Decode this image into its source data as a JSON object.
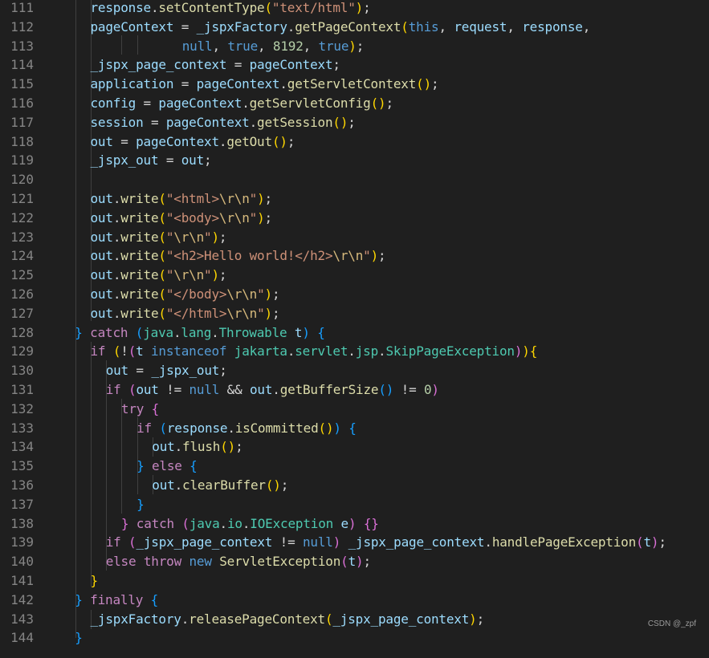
{
  "editor": {
    "lines": [
      {
        "n": "111",
        "t": [
          [
            "response",
            "sv"
          ],
          [
            ".",
            "pu"
          ],
          [
            "setContentType",
            "fn"
          ],
          [
            "(",
            "b1"
          ],
          [
            "\"text/html\"",
            "st"
          ],
          [
            ")",
            "b1"
          ],
          [
            ";",
            "pu"
          ]
        ]
      },
      {
        "n": "112",
        "t": [
          [
            "pageContext",
            "sv"
          ],
          [
            " = ",
            "pu"
          ],
          [
            "_jspxFactory",
            "sv"
          ],
          [
            ".",
            "pu"
          ],
          [
            "getPageContext",
            "fn"
          ],
          [
            "(",
            "b1"
          ],
          [
            "this",
            "kw"
          ],
          [
            ", ",
            "pu"
          ],
          [
            "request",
            "sv"
          ],
          [
            ", ",
            "pu"
          ],
          [
            "response",
            "sv"
          ],
          [
            ",",
            "pu"
          ]
        ]
      },
      {
        "n": "113",
        "t": [
          [
            "      ",
            "pu"
          ],
          [
            "null",
            "kw"
          ],
          [
            ", ",
            "pu"
          ],
          [
            "true",
            "kw"
          ],
          [
            ", ",
            "pu"
          ],
          [
            "8192",
            "nm"
          ],
          [
            ", ",
            "pu"
          ],
          [
            "true",
            "kw"
          ],
          [
            ")",
            "b1"
          ],
          [
            ";",
            "pu"
          ]
        ]
      },
      {
        "n": "114",
        "t": [
          [
            "_jspx_page_context",
            "sv"
          ],
          [
            " = ",
            "pu"
          ],
          [
            "pageContext",
            "sv"
          ],
          [
            ";",
            "pu"
          ]
        ]
      },
      {
        "n": "115",
        "t": [
          [
            "application",
            "sv"
          ],
          [
            " = ",
            "pu"
          ],
          [
            "pageContext",
            "sv"
          ],
          [
            ".",
            "pu"
          ],
          [
            "getServletContext",
            "fn"
          ],
          [
            "(",
            "b1"
          ],
          [
            ")",
            "b1"
          ],
          [
            ";",
            "pu"
          ]
        ]
      },
      {
        "n": "116",
        "t": [
          [
            "config",
            "sv"
          ],
          [
            " = ",
            "pu"
          ],
          [
            "pageContext",
            "sv"
          ],
          [
            ".",
            "pu"
          ],
          [
            "getServletConfig",
            "fn"
          ],
          [
            "(",
            "b1"
          ],
          [
            ")",
            "b1"
          ],
          [
            ";",
            "pu"
          ]
        ]
      },
      {
        "n": "117",
        "t": [
          [
            "session",
            "sv"
          ],
          [
            " = ",
            "pu"
          ],
          [
            "pageContext",
            "sv"
          ],
          [
            ".",
            "pu"
          ],
          [
            "getSession",
            "fn"
          ],
          [
            "(",
            "b1"
          ],
          [
            ")",
            "b1"
          ],
          [
            ";",
            "pu"
          ]
        ]
      },
      {
        "n": "118",
        "t": [
          [
            "out",
            "sv"
          ],
          [
            " = ",
            "pu"
          ],
          [
            "pageContext",
            "sv"
          ],
          [
            ".",
            "pu"
          ],
          [
            "getOut",
            "fn"
          ],
          [
            "(",
            "b1"
          ],
          [
            ")",
            "b1"
          ],
          [
            ";",
            "pu"
          ]
        ]
      },
      {
        "n": "119",
        "t": [
          [
            "_jspx_out",
            "sv"
          ],
          [
            " = ",
            "pu"
          ],
          [
            "out",
            "sv"
          ],
          [
            ";",
            "pu"
          ]
        ]
      },
      {
        "n": "120",
        "t": []
      },
      {
        "n": "121",
        "t": [
          [
            "out",
            "sv"
          ],
          [
            ".",
            "pu"
          ],
          [
            "write",
            "fn"
          ],
          [
            "(",
            "b1"
          ],
          [
            "\"<html>",
            "st"
          ],
          [
            "\\r\\n",
            "es"
          ],
          [
            "\"",
            "st"
          ],
          [
            ")",
            "b1"
          ],
          [
            ";",
            "pu"
          ]
        ]
      },
      {
        "n": "122",
        "t": [
          [
            "out",
            "sv"
          ],
          [
            ".",
            "pu"
          ],
          [
            "write",
            "fn"
          ],
          [
            "(",
            "b1"
          ],
          [
            "\"<body>",
            "st"
          ],
          [
            "\\r\\n",
            "es"
          ],
          [
            "\"",
            "st"
          ],
          [
            ")",
            "b1"
          ],
          [
            ";",
            "pu"
          ]
        ]
      },
      {
        "n": "123",
        "t": [
          [
            "out",
            "sv"
          ],
          [
            ".",
            "pu"
          ],
          [
            "write",
            "fn"
          ],
          [
            "(",
            "b1"
          ],
          [
            "\"",
            "st"
          ],
          [
            "\\r\\n",
            "es"
          ],
          [
            "\"",
            "st"
          ],
          [
            ")",
            "b1"
          ],
          [
            ";",
            "pu"
          ]
        ]
      },
      {
        "n": "124",
        "t": [
          [
            "out",
            "sv"
          ],
          [
            ".",
            "pu"
          ],
          [
            "write",
            "fn"
          ],
          [
            "(",
            "b1"
          ],
          [
            "\"<h2>Hello world!</h2>",
            "st"
          ],
          [
            "\\r\\n",
            "es"
          ],
          [
            "\"",
            "st"
          ],
          [
            ")",
            "b1"
          ],
          [
            ";",
            "pu"
          ]
        ]
      },
      {
        "n": "125",
        "t": [
          [
            "out",
            "sv"
          ],
          [
            ".",
            "pu"
          ],
          [
            "write",
            "fn"
          ],
          [
            "(",
            "b1"
          ],
          [
            "\"",
            "st"
          ],
          [
            "\\r\\n",
            "es"
          ],
          [
            "\"",
            "st"
          ],
          [
            ")",
            "b1"
          ],
          [
            ";",
            "pu"
          ]
        ]
      },
      {
        "n": "126",
        "t": [
          [
            "out",
            "sv"
          ],
          [
            ".",
            "pu"
          ],
          [
            "write",
            "fn"
          ],
          [
            "(",
            "b1"
          ],
          [
            "\"</body>",
            "st"
          ],
          [
            "\\r\\n",
            "es"
          ],
          [
            "\"",
            "st"
          ],
          [
            ")",
            "b1"
          ],
          [
            ";",
            "pu"
          ]
        ]
      },
      {
        "n": "127",
        "t": [
          [
            "out",
            "sv"
          ],
          [
            ".",
            "pu"
          ],
          [
            "write",
            "fn"
          ],
          [
            "(",
            "b1"
          ],
          [
            "\"</html>",
            "st"
          ],
          [
            "\\r\\n",
            "es"
          ],
          [
            "\"",
            "st"
          ],
          [
            ")",
            "b1"
          ],
          [
            ";",
            "pu"
          ]
        ]
      },
      {
        "n": "128",
        "t": [
          [
            "}",
            "b3"
          ],
          [
            " ",
            "pu"
          ],
          [
            "catch",
            "ct"
          ],
          [
            " ",
            "pu"
          ],
          [
            "(",
            "b3"
          ],
          [
            "java",
            "ty"
          ],
          [
            ".",
            "pu"
          ],
          [
            "lang",
            "ty"
          ],
          [
            ".",
            "pu"
          ],
          [
            "Throwable",
            "ty"
          ],
          [
            " ",
            "pu"
          ],
          [
            "t",
            "sv"
          ],
          [
            ")",
            "b3"
          ],
          [
            " ",
            "pu"
          ],
          [
            "{",
            "b3"
          ]
        ]
      },
      {
        "n": "129",
        "t": [
          [
            "if",
            "ct"
          ],
          [
            " ",
            "pu"
          ],
          [
            "(",
            "b1"
          ],
          [
            "!",
            "pu"
          ],
          [
            "(",
            "b2"
          ],
          [
            "t",
            "sv"
          ],
          [
            " ",
            "pu"
          ],
          [
            "instanceof",
            "kw"
          ],
          [
            " ",
            "pu"
          ],
          [
            "jakarta",
            "ty"
          ],
          [
            ".",
            "pu"
          ],
          [
            "servlet",
            "ty"
          ],
          [
            ".",
            "pu"
          ],
          [
            "jsp",
            "ty"
          ],
          [
            ".",
            "pu"
          ],
          [
            "SkipPageException",
            "ty"
          ],
          [
            ")",
            "b2"
          ],
          [
            ")",
            "b1"
          ],
          [
            "{",
            "b1"
          ]
        ]
      },
      {
        "n": "130",
        "t": [
          [
            "out",
            "sv"
          ],
          [
            " = ",
            "pu"
          ],
          [
            "_jspx_out",
            "sv"
          ],
          [
            ";",
            "pu"
          ]
        ]
      },
      {
        "n": "131",
        "t": [
          [
            "if",
            "ct"
          ],
          [
            " ",
            "pu"
          ],
          [
            "(",
            "b2"
          ],
          [
            "out",
            "sv"
          ],
          [
            " != ",
            "pu"
          ],
          [
            "null",
            "kw"
          ],
          [
            " && ",
            "pu"
          ],
          [
            "out",
            "sv"
          ],
          [
            ".",
            "pu"
          ],
          [
            "getBufferSize",
            "fn"
          ],
          [
            "(",
            "b3"
          ],
          [
            ")",
            "b3"
          ],
          [
            " != ",
            "pu"
          ],
          [
            "0",
            "nm"
          ],
          [
            ")",
            "b2"
          ]
        ]
      },
      {
        "n": "132",
        "t": [
          [
            "try",
            "ct"
          ],
          [
            " ",
            "pu"
          ],
          [
            "{",
            "b2"
          ]
        ]
      },
      {
        "n": "133",
        "t": [
          [
            "if",
            "ct"
          ],
          [
            " ",
            "pu"
          ],
          [
            "(",
            "b3"
          ],
          [
            "response",
            "sv"
          ],
          [
            ".",
            "pu"
          ],
          [
            "isCommitted",
            "fn"
          ],
          [
            "(",
            "b1"
          ],
          [
            ")",
            "b1"
          ],
          [
            ")",
            "b3"
          ],
          [
            " ",
            "pu"
          ],
          [
            "{",
            "b3"
          ]
        ]
      },
      {
        "n": "134",
        "t": [
          [
            "out",
            "sv"
          ],
          [
            ".",
            "pu"
          ],
          [
            "flush",
            "fn"
          ],
          [
            "(",
            "b1"
          ],
          [
            ")",
            "b1"
          ],
          [
            ";",
            "pu"
          ]
        ]
      },
      {
        "n": "135",
        "t": [
          [
            "}",
            "b3"
          ],
          [
            " ",
            "pu"
          ],
          [
            "else",
            "ct"
          ],
          [
            " ",
            "pu"
          ],
          [
            "{",
            "b3"
          ]
        ]
      },
      {
        "n": "136",
        "t": [
          [
            "out",
            "sv"
          ],
          [
            ".",
            "pu"
          ],
          [
            "clearBuffer",
            "fn"
          ],
          [
            "(",
            "b1"
          ],
          [
            ")",
            "b1"
          ],
          [
            ";",
            "pu"
          ]
        ]
      },
      {
        "n": "137",
        "t": [
          [
            "}",
            "b3"
          ]
        ]
      },
      {
        "n": "138",
        "t": [
          [
            "}",
            "b2"
          ],
          [
            " ",
            "pu"
          ],
          [
            "catch",
            "ct"
          ],
          [
            " ",
            "pu"
          ],
          [
            "(",
            "b2"
          ],
          [
            "java",
            "ty"
          ],
          [
            ".",
            "pu"
          ],
          [
            "io",
            "ty"
          ],
          [
            ".",
            "pu"
          ],
          [
            "IOException",
            "ty"
          ],
          [
            " ",
            "pu"
          ],
          [
            "e",
            "sv"
          ],
          [
            ")",
            "b2"
          ],
          [
            " ",
            "pu"
          ],
          [
            "{}",
            "b2"
          ]
        ]
      },
      {
        "n": "139",
        "t": [
          [
            "if",
            "ct"
          ],
          [
            " ",
            "pu"
          ],
          [
            "(",
            "b2"
          ],
          [
            "_jspx_page_context",
            "sv"
          ],
          [
            " != ",
            "pu"
          ],
          [
            "null",
            "kw"
          ],
          [
            ")",
            "b2"
          ],
          [
            " ",
            "pu"
          ],
          [
            "_jspx_page_context",
            "sv"
          ],
          [
            ".",
            "pu"
          ],
          [
            "handlePageException",
            "fn"
          ],
          [
            "(",
            "b2"
          ],
          [
            "t",
            "sv"
          ],
          [
            ")",
            "b2"
          ],
          [
            ";",
            "pu"
          ]
        ]
      },
      {
        "n": "140",
        "t": [
          [
            "else",
            "ct"
          ],
          [
            " ",
            "pu"
          ],
          [
            "throw",
            "ct"
          ],
          [
            " ",
            "pu"
          ],
          [
            "new",
            "kw"
          ],
          [
            " ",
            "pu"
          ],
          [
            "ServletException",
            "fn"
          ],
          [
            "(",
            "b2"
          ],
          [
            "t",
            "sv"
          ],
          [
            ")",
            "b2"
          ],
          [
            ";",
            "pu"
          ]
        ]
      },
      {
        "n": "141",
        "t": [
          [
            "}",
            "b1"
          ]
        ]
      },
      {
        "n": "142",
        "t": [
          [
            "}",
            "b3"
          ],
          [
            " ",
            "pu"
          ],
          [
            "finally",
            "ct"
          ],
          [
            " ",
            "pu"
          ],
          [
            "{",
            "b3"
          ]
        ]
      },
      {
        "n": "143",
        "t": [
          [
            "_jspxFactory",
            "sv"
          ],
          [
            ".",
            "pu"
          ],
          [
            "releasePageContext",
            "fn"
          ],
          [
            "(",
            "b1"
          ],
          [
            "_jspx_page_context",
            "sv"
          ],
          [
            ")",
            "b1"
          ],
          [
            ";",
            "pu"
          ]
        ]
      },
      {
        "n": "144",
        "t": [
          [
            "}",
            "b3"
          ]
        ]
      }
    ]
  },
  "watermark": "CSDN @_zpf",
  "colors": {
    "background": "#1f1f1f",
    "line_number": "#858585",
    "variable": "#9cdcfe",
    "function": "#dcdcaa",
    "string": "#ce9178",
    "keyword": "#569cd6",
    "control": "#c586c0",
    "type": "#4ec9b0",
    "number": "#b5cea8"
  }
}
